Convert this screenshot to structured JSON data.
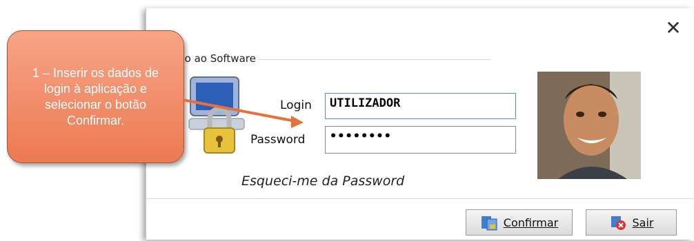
{
  "dialog": {
    "group_title": "sso ao Software",
    "login_label": "Login",
    "login_value": "UTILIZADOR",
    "password_label": "Password",
    "password_value": "••••••••",
    "forgot_link": "Esqueci-me da Password",
    "confirm_label": "Confirmar",
    "exit_label": "Sair",
    "close_glyph": "✕"
  },
  "callout": {
    "text": "1 – Inserir os dados de login à aplicação e selecionar o botão Confirmar."
  },
  "colors": {
    "callout_fill": "#ec7a52",
    "field_border": "#4a90d9"
  }
}
